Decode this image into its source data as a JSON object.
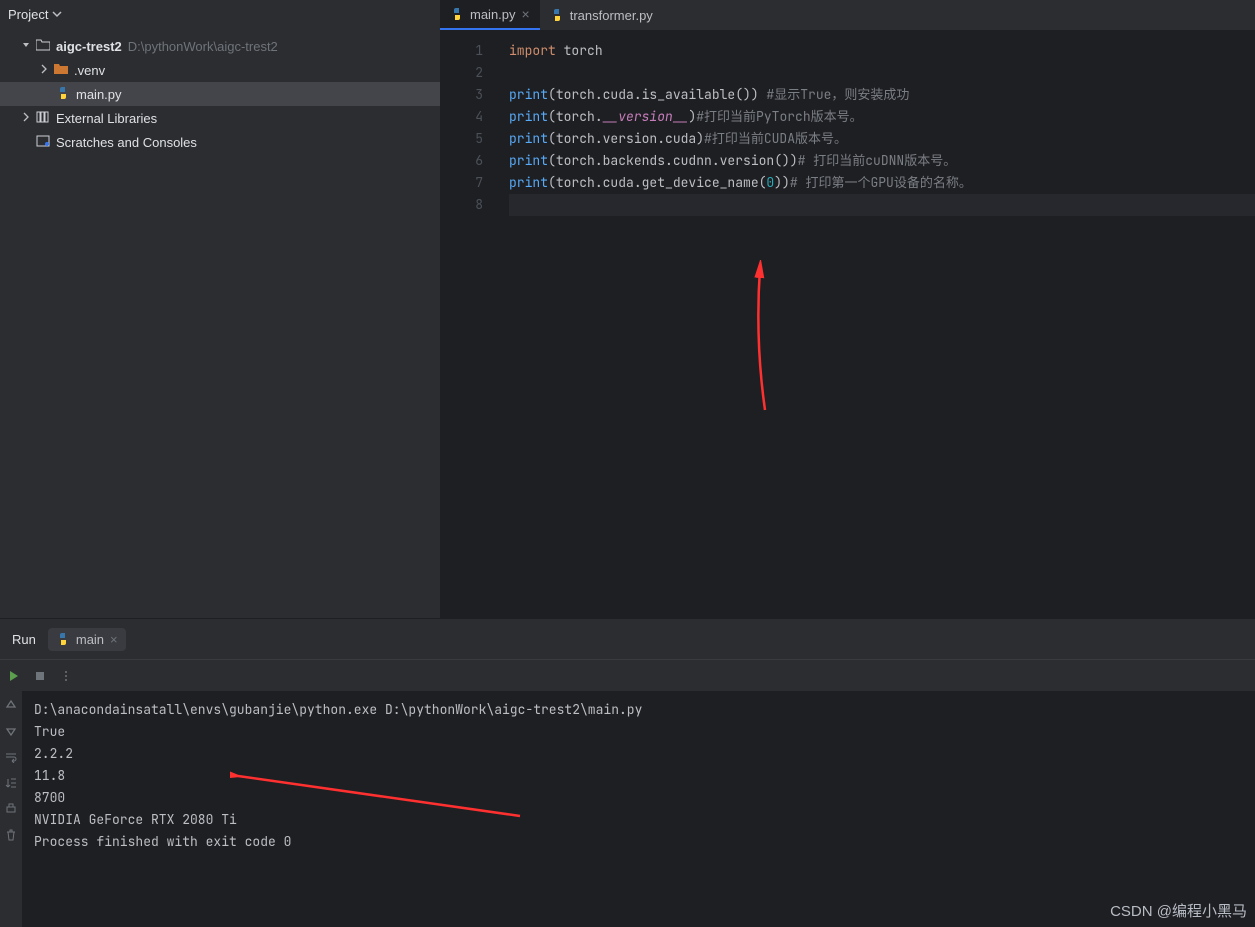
{
  "sidebar": {
    "title": "Project",
    "root": {
      "name": "aigc-trest2",
      "path": "D:\\pythonWork\\aigc-trest2"
    },
    "venv": ".venv",
    "mainpy": "main.py",
    "external": "External Libraries",
    "scratches": "Scratches and Consoles"
  },
  "tabs": {
    "main": "main.py",
    "transformer": "transformer.py"
  },
  "code": {
    "lines": [
      "1",
      "2",
      "3",
      "4",
      "5",
      "6",
      "7",
      "8"
    ],
    "l1": {
      "kw": "import",
      "id": "torch"
    },
    "l3": {
      "fn": "print",
      "body": "(torch.cuda.is_available())",
      "cm": " #显示True，则安装成功"
    },
    "l4": {
      "fn": "print",
      "body_a": "(torch.",
      "dunder": "__version__",
      "body_b": ")",
      "cm": "#打印当前PyTorch版本号。"
    },
    "l5": {
      "fn": "print",
      "body": "(torch.version.cuda)",
      "cm": "#打印当前CUDA版本号。"
    },
    "l6": {
      "fn": "print",
      "body": "(torch.backends.cudnn.version())",
      "cm": "# 打印当前cuDNN版本号。"
    },
    "l7": {
      "fn": "print",
      "body_a": "(torch.cuda.get_device_name(",
      "num": "0",
      "body_b": "))",
      "cm": "# 打印第一个GPU设备的名称。"
    }
  },
  "run": {
    "label": "Run",
    "tab": "main"
  },
  "console": {
    "cmd": "D:\\anacondainsatall\\envs\\gubanjie\\python.exe D:\\pythonWork\\aigc-trest2\\main.py",
    "out1": "True",
    "out2": "2.2.2",
    "out3": "11.8",
    "out4": "8700",
    "out5": "NVIDIA GeForce RTX 2080 Ti",
    "out6": "",
    "out7": "Process finished with exit code 0"
  },
  "watermark": "CSDN @编程小黑马"
}
